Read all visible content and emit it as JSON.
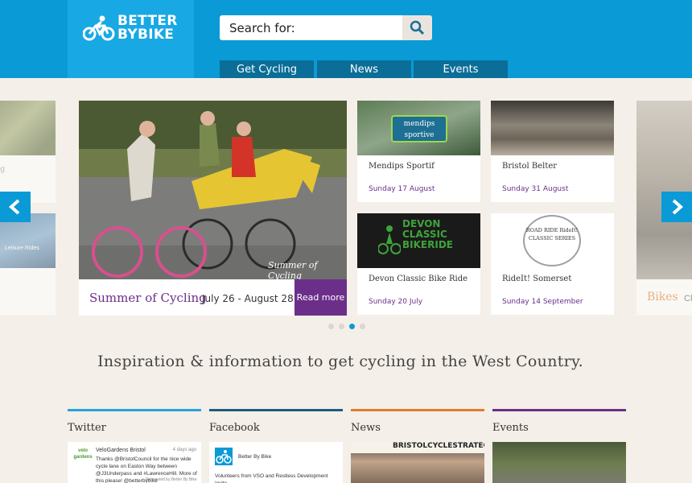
{
  "header": {
    "logo_line1": "BETTER",
    "logo_line2": "BYBIKE",
    "search_label": "Search for:",
    "nav": [
      "Get Cycling",
      "News",
      "Events"
    ]
  },
  "carousel": {
    "left_partial_title": "g",
    "left_partial_img_text": "Leisure Rides",
    "right_partial_title": "Bikes",
    "right_partial_extra": "Ch",
    "main": {
      "title": "Summer of Cycling",
      "dates": "July 26 - August 28",
      "read_more": "Read more",
      "img_text": "Summer of Cycling"
    },
    "events": [
      {
        "title": "Mendips Sportif",
        "date": "Sunday 17 August",
        "img_text": "mendips sportive"
      },
      {
        "title": "Bristol Belter",
        "date": "Sunday 31 August",
        "img_text": ""
      },
      {
        "title": "Devon Classic Bike Ride",
        "date": "Sunday 20 July",
        "img_text": "DEVON CLASSIC BIKERIDE"
      },
      {
        "title": "RideIt! Somerset",
        "date": "Sunday 14 September",
        "img_text": "ROAD RIDE RideIt! CLASSIC SERIES"
      }
    ],
    "dots": 4,
    "active_dot": 2
  },
  "tagline": "Inspiration & information to get cycling in the West Country.",
  "columns": {
    "twitter": {
      "title": "Twitter",
      "logo_text": "velo gardens",
      "name": "VeloGardens Bristol",
      "ago": "4 days ago",
      "text": "Thanks @BristolCouncil for the nice wide cycle lane on Easton Way between @J3Underpass and #LawrenceHill. More of this please! @betterbybike",
      "retweet": "Retweeted by Better By Bike"
    },
    "facebook": {
      "title": "Facebook",
      "name": "Better By Bike",
      "text": "Volunteers from VSO and Restless Development invite"
    },
    "news": {
      "title": "News",
      "banner": "BRISTOLCYCLESTRATEGY"
    },
    "events": {
      "title": "Events"
    }
  },
  "colors": {
    "header": "#0a9ad6",
    "accent_purple": "#6b2f8a",
    "nav_tab": "#0a6e98",
    "bar_twitter": "#26a3df",
    "bar_facebook": "#1d5c80",
    "bar_news": "#e37c2b",
    "bar_events": "#6b2f8a"
  },
  "icons": [
    "bike-logo-icon",
    "search-icon",
    "arrow-left-icon",
    "arrow-right-icon",
    "facebook-avatar-icon"
  ]
}
